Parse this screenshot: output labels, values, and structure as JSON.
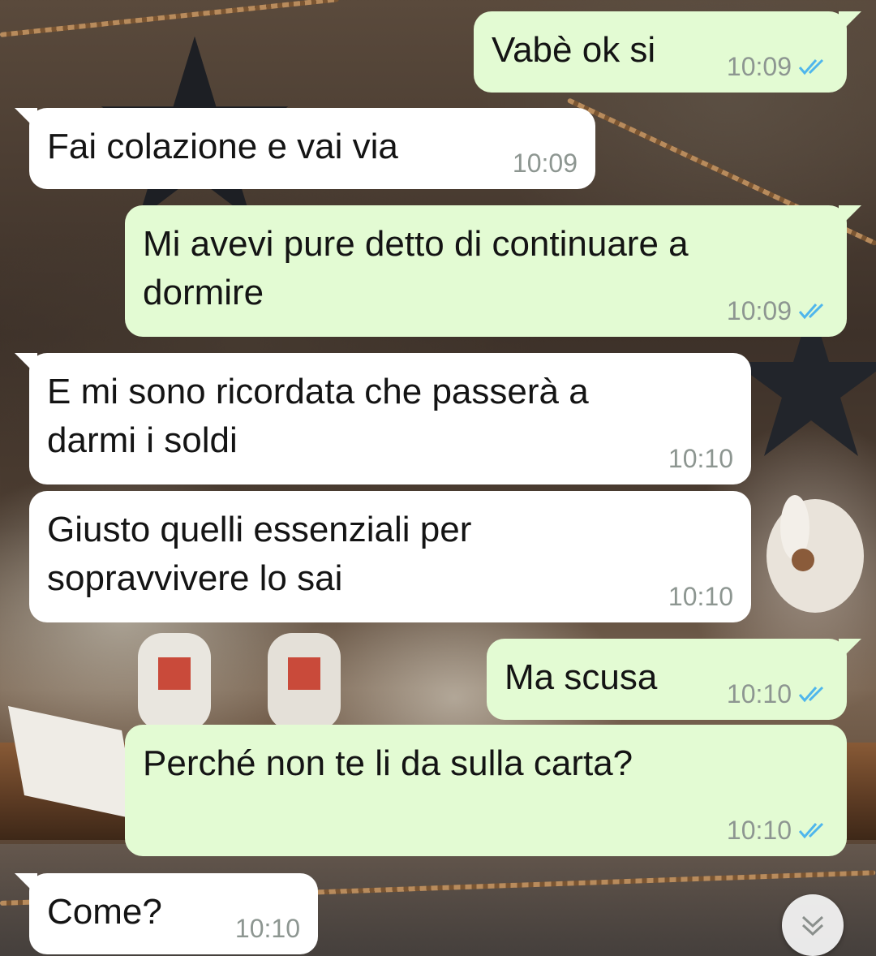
{
  "chat": {
    "messages": [
      {
        "direction": "out",
        "text": "Vabè ok si",
        "time": "10:09",
        "status": "read"
      },
      {
        "direction": "in",
        "text": "Fai colazione e vai via",
        "time": "10:09"
      },
      {
        "direction": "out",
        "text": "Mi avevi pure detto di continuare a\ndormire",
        "time": "10:09",
        "status": "read"
      },
      {
        "direction": "in",
        "text": "E mi sono ricordata che passerà a\ndarmi i soldi",
        "time": "10:10"
      },
      {
        "direction": "in",
        "text": "Giusto quelli essenziali per\nsopravvivere lo sai",
        "time": "10:10"
      },
      {
        "direction": "out",
        "text": "Ma scusa",
        "time": "10:10",
        "status": "read"
      },
      {
        "direction": "out",
        "text": "Perché non te li da sulla carta?",
        "time": "10:10",
        "status": "read"
      },
      {
        "direction": "in",
        "text": "Come?",
        "time": "10:10"
      }
    ]
  },
  "icons": {
    "read_receipt": "double-check-icon",
    "scroll_down": "double-chevron-down-icon"
  },
  "colors": {
    "incoming_bubble": "#ffffff",
    "outgoing_bubble": "#e3fbd3",
    "read_tick": "#4fb6ec",
    "timestamp": "#8d9691"
  }
}
